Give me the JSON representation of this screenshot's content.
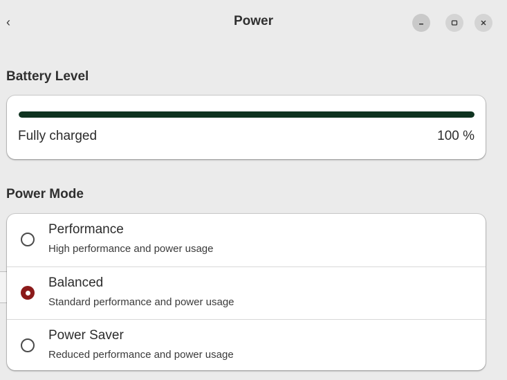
{
  "window": {
    "title": "Power",
    "back_icon": "chevron-left-icon",
    "controls": [
      "minimize-icon",
      "maximize-icon",
      "close-icon"
    ]
  },
  "battery": {
    "section_title": "Battery Level",
    "status": "Fully charged",
    "percent_text": "100 %",
    "level": 1.0,
    "bar_color": "#0f3320"
  },
  "power_mode": {
    "section_title": "Power Mode",
    "selected": "Balanced",
    "accent_color": "#8b1a1a",
    "options": [
      {
        "name": "Performance",
        "description": "High performance and power usage"
      },
      {
        "name": "Balanced",
        "description": "Standard performance and power usage"
      },
      {
        "name": "Power Saver",
        "description": "Reduced performance and power usage"
      }
    ]
  }
}
